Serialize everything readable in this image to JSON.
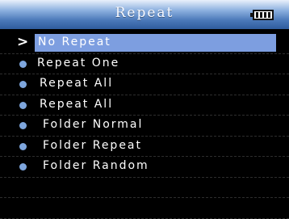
{
  "header": {
    "title": "Repeat",
    "battery_icon": "battery-full-icon"
  },
  "menu": {
    "selected_marker": ">",
    "items": [
      {
        "label": "No Repeat",
        "selected": true
      },
      {
        "label": "Repeat One",
        "selected": false
      },
      {
        "label": "Repeat All",
        "selected": false
      },
      {
        "label": "Repeat All",
        "selected": false
      },
      {
        "label": "Folder Normal",
        "selected": false
      },
      {
        "label": "Folder Repeat",
        "selected": false
      },
      {
        "label": "Folder Random",
        "selected": false
      }
    ]
  },
  "colors": {
    "title_bar": "#4a78b8",
    "selection": "#7d9ee0",
    "bullet": "#7ea6dd",
    "background": "#000000"
  }
}
